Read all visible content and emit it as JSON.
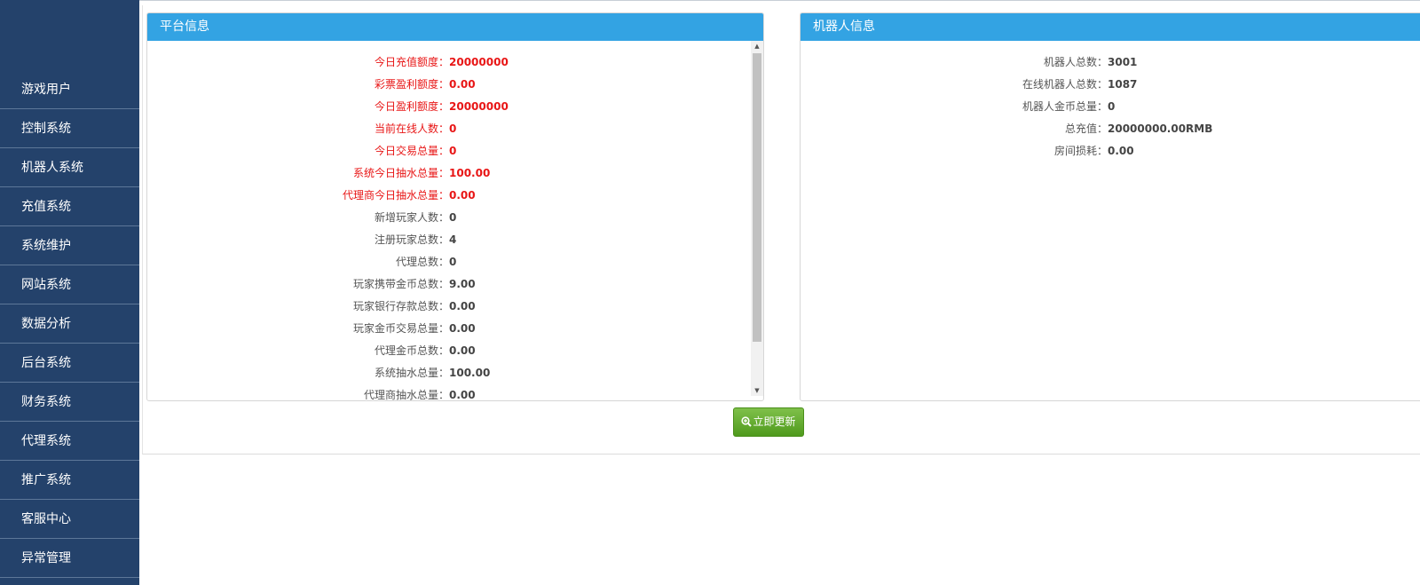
{
  "sidebar": {
    "items": [
      {
        "label": "游戏用户"
      },
      {
        "label": "控制系统"
      },
      {
        "label": "机器人系统"
      },
      {
        "label": "充值系统"
      },
      {
        "label": "系统维护"
      },
      {
        "label": "网站系统"
      },
      {
        "label": "数据分析"
      },
      {
        "label": "后台系统"
      },
      {
        "label": "财务系统"
      },
      {
        "label": "代理系统"
      },
      {
        "label": "推广系统"
      },
      {
        "label": "客服中心"
      },
      {
        "label": "异常管理"
      }
    ]
  },
  "platform": {
    "title": "平台信息",
    "rows": [
      {
        "label": "今日充值额度：",
        "value": "20000000",
        "highlight": true
      },
      {
        "label": "彩票盈利额度：",
        "value": "0.00",
        "highlight": true
      },
      {
        "label": "今日盈利额度：",
        "value": "20000000",
        "highlight": true
      },
      {
        "label": "当前在线人数：",
        "value": "0",
        "highlight": true
      },
      {
        "label": "今日交易总量：",
        "value": "0",
        "highlight": true
      },
      {
        "label": "系统今日抽水总量：",
        "value": "100.00",
        "highlight": true
      },
      {
        "label": "代理商今日抽水总量：",
        "value": "0.00",
        "highlight": true
      },
      {
        "label": "新增玩家人数：",
        "value": "0",
        "highlight": false
      },
      {
        "label": "注册玩家总数：",
        "value": "4",
        "highlight": false
      },
      {
        "label": "代理总数：",
        "value": "0",
        "highlight": false
      },
      {
        "label": "玩家携带金币总数：",
        "value": "9.00",
        "highlight": false
      },
      {
        "label": "玩家银行存款总数：",
        "value": "0.00",
        "highlight": false
      },
      {
        "label": "玩家金币交易总量：",
        "value": "0.00",
        "highlight": false
      },
      {
        "label": "代理金币总数：",
        "value": "0.00",
        "highlight": false
      },
      {
        "label": "系统抽水总量：",
        "value": "100.00",
        "highlight": false
      },
      {
        "label": "代理商抽水总量：",
        "value": "0.00",
        "highlight": false
      }
    ]
  },
  "robot": {
    "title": "机器人信息",
    "rows": [
      {
        "label": "机器人总数：",
        "value": "3001"
      },
      {
        "label": "在线机器人总数：",
        "value": "1087"
      },
      {
        "label": "机器人金币总量：",
        "value": "0"
      },
      {
        "label": "总充值：",
        "value": "20000000.00RMB"
      },
      {
        "label": "房间损耗：",
        "value": "0.00"
      }
    ]
  },
  "actions": {
    "refresh_label": "立即更新",
    "refresh_icon": "zoom-in-icon"
  },
  "colors": {
    "sidebar_bg": "#24426b",
    "panel_header": "#33a3e3",
    "highlight_text": "#e81616",
    "button_green": "#5faa2c"
  }
}
